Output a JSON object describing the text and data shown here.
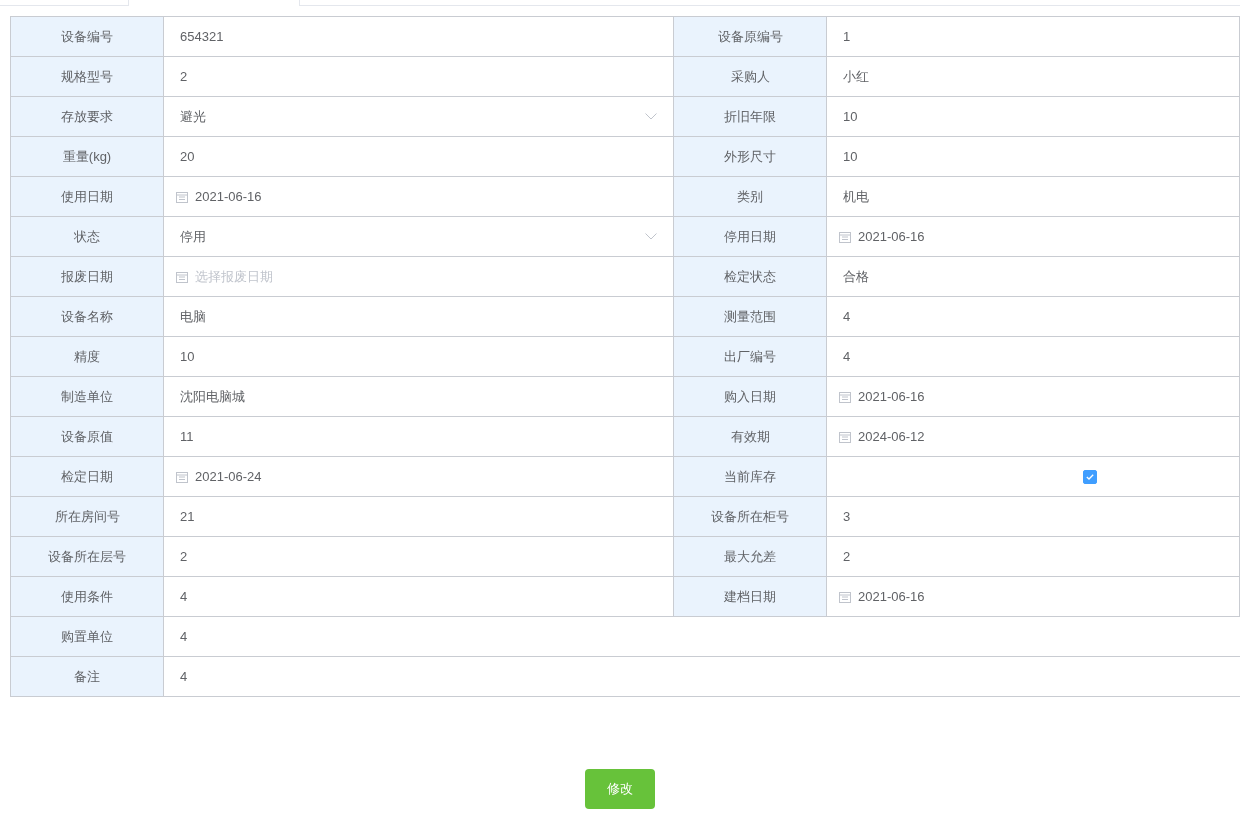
{
  "rows": [
    [
      {
        "label": "设备编号",
        "kind": "text",
        "value": "654321"
      },
      {
        "label": "设备原编号",
        "kind": "text",
        "value": "1"
      }
    ],
    [
      {
        "label": "规格型号",
        "kind": "text",
        "value": "2"
      },
      {
        "label": "采购人",
        "kind": "text",
        "value": "小红"
      }
    ],
    [
      {
        "label": "存放要求",
        "kind": "select",
        "value": "避光"
      },
      {
        "label": "折旧年限",
        "kind": "text",
        "value": "10"
      }
    ],
    [
      {
        "label": "重量(kg)",
        "kind": "text",
        "value": "20"
      },
      {
        "label": "外形尺寸",
        "kind": "text",
        "value": "10"
      }
    ],
    [
      {
        "label": "使用日期",
        "kind": "date",
        "value": "2021-06-16"
      },
      {
        "label": "类别",
        "kind": "text",
        "value": "机电"
      }
    ],
    [
      {
        "label": "状态",
        "kind": "select",
        "value": "停用"
      },
      {
        "label": "停用日期",
        "kind": "date",
        "value": "2021-06-16"
      }
    ],
    [
      {
        "label": "报废日期",
        "kind": "date",
        "placeholder": "选择报废日期"
      },
      {
        "label": "检定状态",
        "kind": "text",
        "value": "合格"
      }
    ],
    [
      {
        "label": "设备名称",
        "kind": "text",
        "value": "电脑"
      },
      {
        "label": "测量范围",
        "kind": "text",
        "value": "4"
      }
    ],
    [
      {
        "label": "精度",
        "kind": "text",
        "value": "10"
      },
      {
        "label": "出厂编号",
        "kind": "text",
        "value": "4"
      }
    ],
    [
      {
        "label": "制造单位",
        "kind": "text",
        "value": "沈阳电脑城"
      },
      {
        "label": "购入日期",
        "kind": "date",
        "value": "2021-06-16"
      }
    ],
    [
      {
        "label": "设备原值",
        "kind": "text",
        "value": "11"
      },
      {
        "label": "有效期",
        "kind": "date",
        "value": "2024-06-12"
      }
    ],
    [
      {
        "label": "检定日期",
        "kind": "date",
        "value": "2021-06-24"
      },
      {
        "label": "当前库存",
        "kind": "checkbox",
        "checked": true
      }
    ],
    [
      {
        "label": "所在房间号",
        "kind": "text",
        "value": "21"
      },
      {
        "label": "设备所在柜号",
        "kind": "text",
        "value": "3"
      }
    ],
    [
      {
        "label": "设备所在层号",
        "kind": "text",
        "value": "2"
      },
      {
        "label": "最大允差",
        "kind": "text",
        "value": "2"
      }
    ],
    [
      {
        "label": "使用条件",
        "kind": "text",
        "value": "4"
      },
      {
        "label": "建档日期",
        "kind": "date",
        "value": "2021-06-16"
      }
    ],
    [
      {
        "label": "购置单位",
        "kind": "text",
        "value": "4"
      }
    ],
    [
      {
        "label": "备注",
        "kind": "text",
        "value": "4"
      }
    ]
  ],
  "submit_button": "修改"
}
